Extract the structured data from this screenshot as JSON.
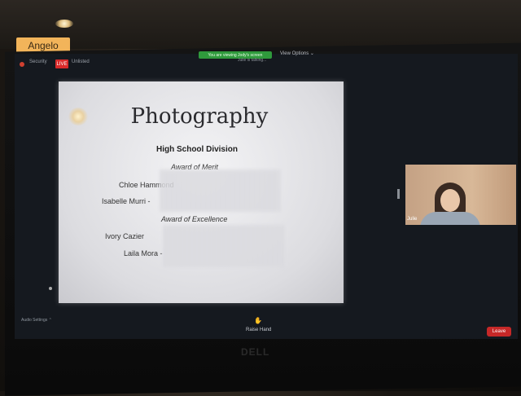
{
  "room": {
    "name_tag": "Angelo"
  },
  "meeting": {
    "security_label": "Security",
    "live_label": "LIVE",
    "stream_label": "Unlisted",
    "share_banner": "You are viewing Jody's screen",
    "talking_label": "Julie is talking...",
    "view_options": "View Options ⌄"
  },
  "slide": {
    "title": "Photography",
    "division": "High School Division",
    "award_merit": "Award of Merit",
    "award_excellence": "Award of Excellence",
    "names": [
      "Chloe Hammond",
      "Isabelle Murri -",
      "Ivory Cazier",
      "Laila Mora -"
    ]
  },
  "participant": {
    "name": "Julie"
  },
  "toolbar": {
    "audio_settings": "Audio Settings ⌃",
    "raise_hand_label": "Raise Hand",
    "leave_label": "Leave"
  },
  "monitor": {
    "brand": "DELL"
  }
}
